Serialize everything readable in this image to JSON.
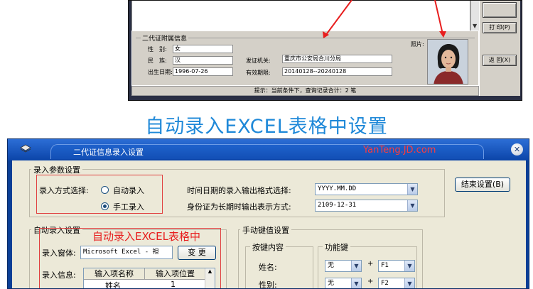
{
  "top_window": {
    "section_title": "二代证附属信息",
    "fields": {
      "gender_label": "性　别:",
      "gender_value": "女",
      "ethnicity_label": "民　族:",
      "ethnicity_value": "汉",
      "birth_label": "出生日期:",
      "birth_value": "1996-07-26",
      "authority_label": "发证机关:",
      "authority_value": "重庆市公安局合川分局",
      "validity_label": "有效期限:",
      "validity_value": "20140128--20240128",
      "photo_label": "照片:"
    },
    "status_text": "提示：当前条件下，查询记录合计：2 笔",
    "buttons": {
      "print": "打 印(P)",
      "back": "返 回(X)"
    }
  },
  "headline": "自动录入EXCEL表格中设置",
  "dialog": {
    "title": "二代证信息录入设置",
    "watermark": "YanTeng.JD.com",
    "close_glyph": "✕",
    "params_group": {
      "title": "录入参数设置",
      "mode_label": "录入方式选择:",
      "option_auto": "自动录入",
      "option_manual": "手工录入",
      "selected": "手工录入",
      "datetime_format_label": "时间日期的录入输出格式选择:",
      "datetime_format_value": "YYYY.MM.DD",
      "longterm_label": "身份证为长期时输出表示方式:",
      "longterm_value": "2109-12-31"
    },
    "finish_button": "结束设置(B)",
    "auto_group": {
      "title": "自动录入设置",
      "annotation": "自动录入EXCEL表格中",
      "window_label": "录入窗体:",
      "window_value": "Microsoft Excel - 袒",
      "change_button": "变 更",
      "info_label": "录入信息:",
      "columns": [
        "输入项名称",
        "输入项位置"
      ],
      "rows": [
        [
          "姓名",
          "1"
        ]
      ]
    },
    "hotkey_group": {
      "title": "手动键值设置",
      "content_title": "按键内容",
      "function_title": "功能键",
      "rows": [
        {
          "label": "姓名:",
          "key1": "无",
          "plus": "+",
          "key2": "F1"
        },
        {
          "label": "性别:",
          "key1": "无",
          "plus": "+",
          "key2": "F2"
        }
      ]
    }
  }
}
